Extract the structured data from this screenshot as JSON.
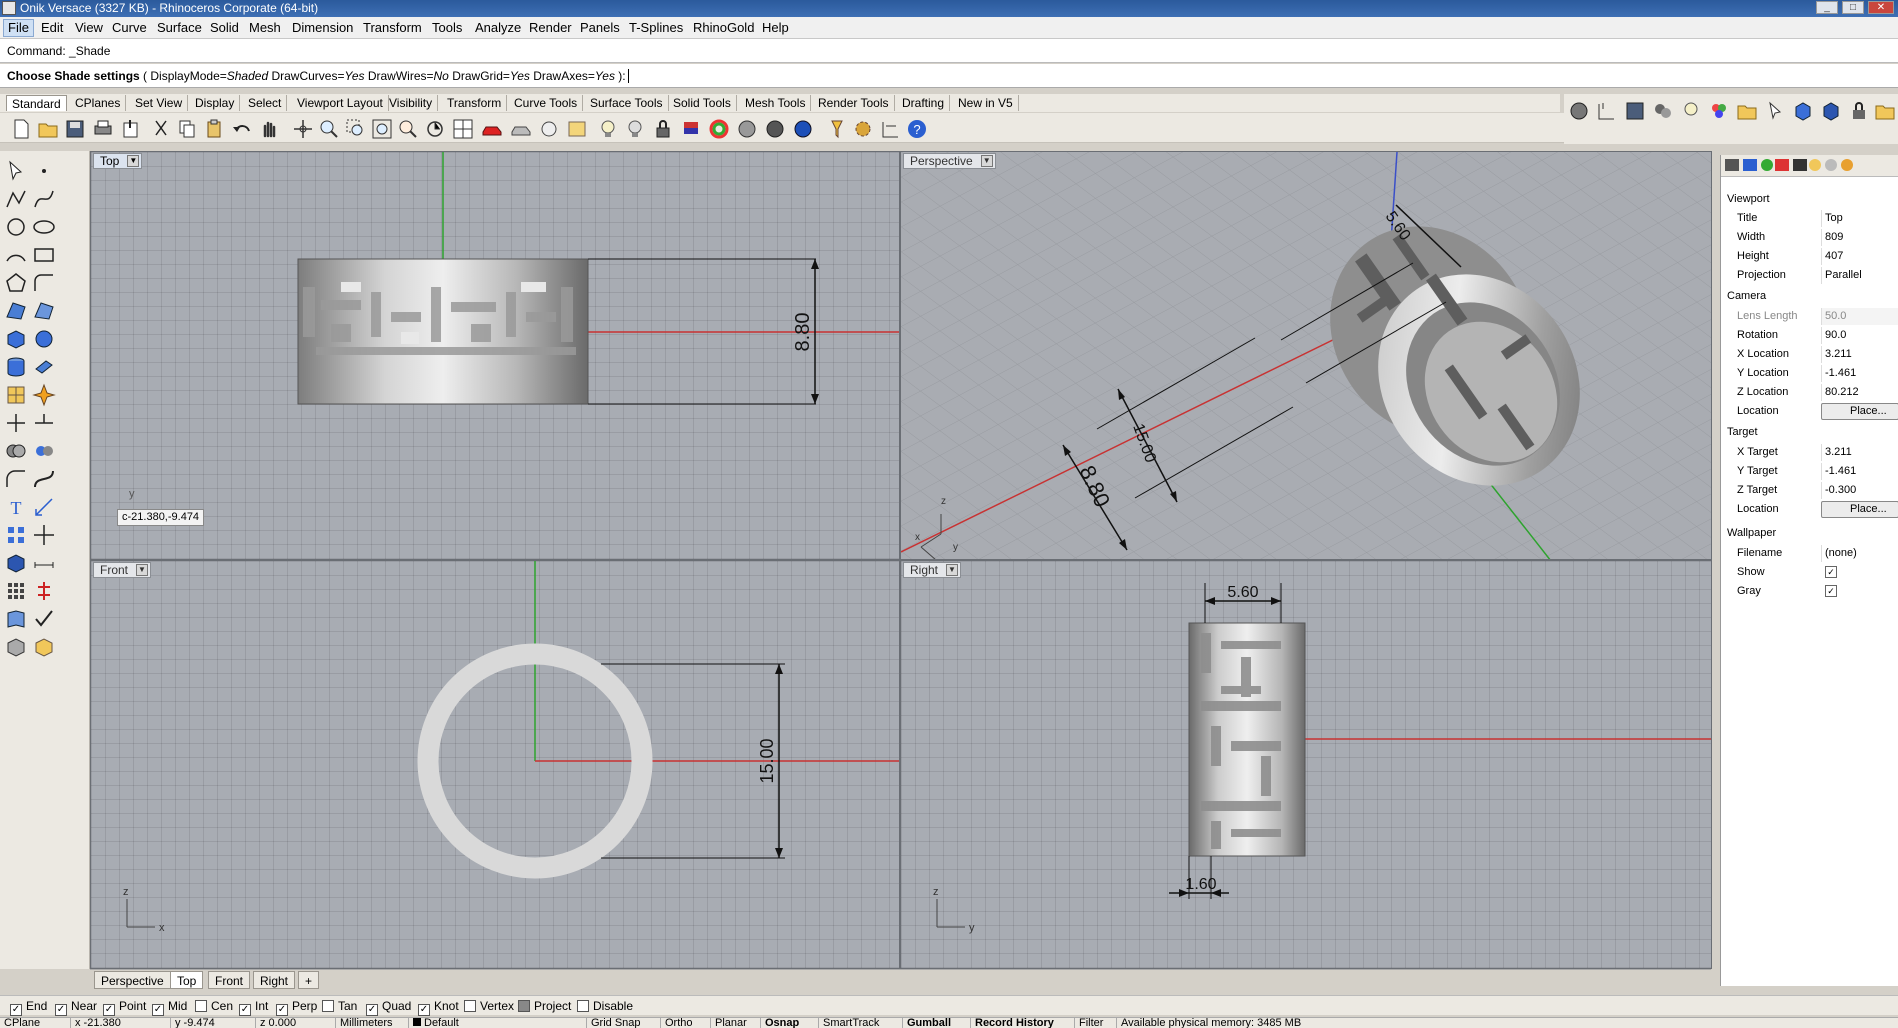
{
  "window": {
    "title": "Onik Versace (3327 KB) - Rhinoceros Corporate (64-bit)",
    "min": "_",
    "max": "□",
    "close": "✕"
  },
  "menu": [
    "File",
    "Edit",
    "View",
    "Curve",
    "Surface",
    "Solid",
    "Mesh",
    "Dimension",
    "Transform",
    "Tools",
    "Analyze",
    "Render",
    "Panels",
    "T-Splines",
    "RhinoGold",
    "Help"
  ],
  "command": {
    "history": "Command: _Shade",
    "prompt": "Choose Shade settings",
    "opts_open": " ( ",
    "o1": "DisplayMode=",
    "o1v": "Shaded",
    "o2": "  DrawCurves=",
    "o2v": "Yes",
    "o3": "  DrawWires=",
    "o3v": "No",
    "o4": "  DrawGrid=",
    "o4v": "Yes",
    "o5": "  DrawAxes=",
    "o5v": "Yes",
    "close": " ):"
  },
  "toolbar_tabs": [
    "Standard",
    "CPlanes",
    "Set View",
    "Display",
    "Select",
    "Viewport Layout",
    "Visibility",
    "Transform",
    "Curve Tools",
    "Surface Tools",
    "Solid Tools",
    "Mesh Tools",
    "Render Tools",
    "Drafting",
    "New in V5"
  ],
  "viewports": {
    "top": {
      "label": "Top",
      "dim": "8.80",
      "coord": "c-21.380,-9.474",
      "axis_y": "y"
    },
    "perspective": {
      "label": "Perspective",
      "dim_a": "5.60",
      "dim_b": "15.00",
      "dim_c": "8.80",
      "axis_x": "x",
      "axis_y": "y",
      "axis_z": "z"
    },
    "front": {
      "label": "Front",
      "dim": "15.00",
      "axis_x": "x",
      "axis_z": "z"
    },
    "right": {
      "label": "Right",
      "dim_a": "5.60",
      "dim_b": "1.60",
      "axis_y": "y",
      "axis_z": "z"
    }
  },
  "viewport_tabs": [
    "Perspective",
    "Top",
    "Front",
    "Right"
  ],
  "viewport_tab_add": "+",
  "properties": {
    "viewport_section": "Viewport",
    "rows1": [
      {
        "label": "Title",
        "value": "Top"
      },
      {
        "label": "Width",
        "value": "809"
      },
      {
        "label": "Height",
        "value": "407"
      },
      {
        "label": "Projection",
        "value": "Parallel"
      }
    ],
    "camera_section": "Camera",
    "lens": {
      "label": "Lens Length",
      "value": "50.0"
    },
    "rows2": [
      {
        "label": "Rotation",
        "value": "90.0"
      },
      {
        "label": "X Location",
        "value": "3.211"
      },
      {
        "label": "Y Location",
        "value": "-1.461"
      },
      {
        "label": "Z Location",
        "value": "80.212"
      }
    ],
    "loc1": {
      "label": "Location",
      "button": "Place..."
    },
    "target_section": "Target",
    "rows3": [
      {
        "label": "X Target",
        "value": "3.211"
      },
      {
        "label": "Y Target",
        "value": "-1.461"
      },
      {
        "label": "Z Target",
        "value": "-0.300"
      }
    ],
    "loc2": {
      "label": "Location",
      "button": "Place..."
    },
    "wallpaper_section": "Wallpaper",
    "filename": {
      "label": "Filename",
      "value": "(none)"
    },
    "show": {
      "label": "Show",
      "checked": true
    },
    "gray": {
      "label": "Gray",
      "checked": true
    }
  },
  "osnaps": [
    {
      "label": "End",
      "checked": true
    },
    {
      "label": "Near",
      "checked": true
    },
    {
      "label": "Point",
      "checked": true
    },
    {
      "label": "Mid",
      "checked": true
    },
    {
      "label": "Cen",
      "checked": false
    },
    {
      "label": "Int",
      "checked": true
    },
    {
      "label": "Perp",
      "checked": true
    },
    {
      "label": "Tan",
      "checked": false
    },
    {
      "label": "Quad",
      "checked": true
    },
    {
      "label": "Knot",
      "checked": true
    },
    {
      "label": "Vertex",
      "checked": false
    },
    {
      "label": "Project",
      "checked": false
    },
    {
      "label": "Disable",
      "checked": false
    }
  ],
  "status": [
    "CPlane",
    "x -21.380",
    "y -9.474",
    "z 0.000",
    "Millimeters",
    "Default",
    "Grid Snap",
    "Ortho",
    "Planar",
    "Osnap",
    "SmartTrack",
    "Gumball",
    "Record History",
    "Filter",
    "Available physical memory: 3485 MB"
  ]
}
